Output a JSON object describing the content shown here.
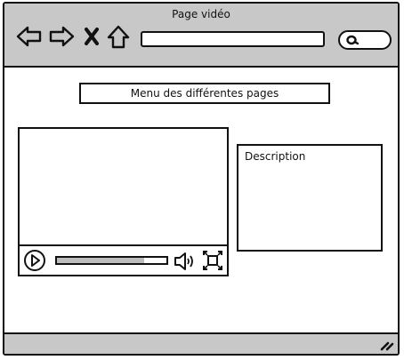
{
  "window": {
    "title": "Page vidéo"
  },
  "toolbar": {
    "back_icon": "arrow-left-icon",
    "forward_icon": "arrow-right-icon",
    "stop_icon": "close-icon",
    "home_icon": "home-icon",
    "address_value": "",
    "search_icon": "search-icon"
  },
  "main": {
    "menu_label": "Menu des différentes pages",
    "video": {
      "progress": 0.8,
      "play_icon": "play-icon",
      "volume_icon": "volume-icon",
      "fullscreen_icon": "fullscreen-icon"
    },
    "description_label": "Description"
  },
  "colors": {
    "chrome": "#c8c8c8",
    "border": "#111111",
    "progress_fill": "#bdbdbd"
  }
}
